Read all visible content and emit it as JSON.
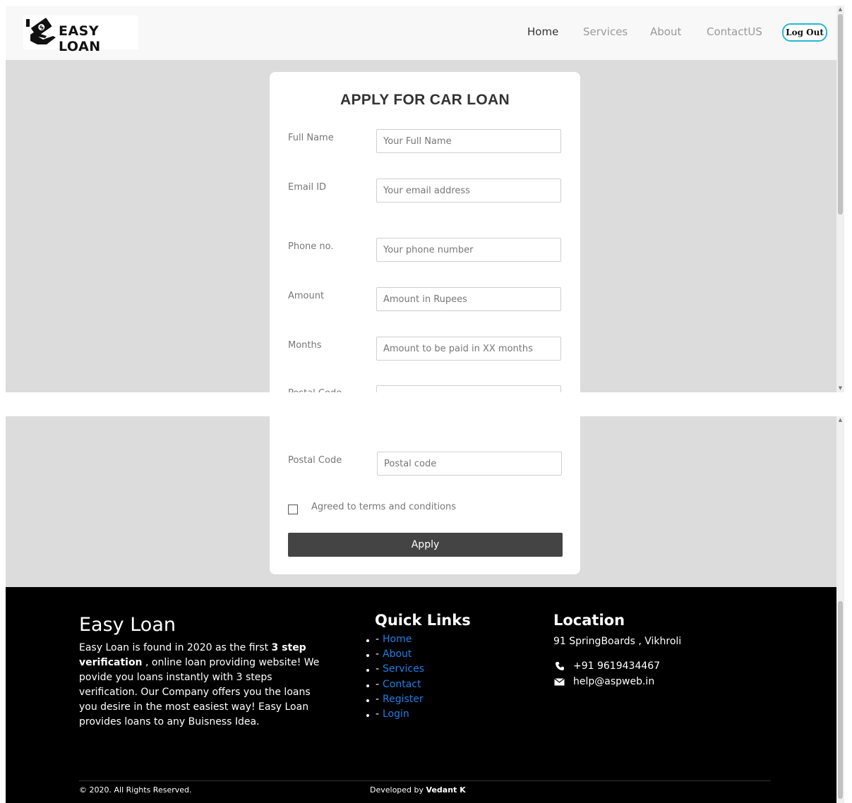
{
  "nav": {
    "brand": "EASY LOAN",
    "links": [
      "Home",
      "Services",
      "About",
      "ContactUS"
    ],
    "logout": "Log Out"
  },
  "form": {
    "title": "APPLY FOR CAR LOAN",
    "fields": [
      {
        "label": "Full Name",
        "placeholder": "Your Full Name"
      },
      {
        "label": "Email ID",
        "placeholder": "Your email address"
      },
      {
        "label": "Phone no.",
        "placeholder": "Your phone number"
      },
      {
        "label": "Amount",
        "placeholder": "Amount in Rupees"
      },
      {
        "label": "Months",
        "placeholder": "Amount to be paid in XX months"
      },
      {
        "label": "Postal Code",
        "placeholder": "Postal code"
      }
    ],
    "terms": "Agreed to terms and conditions",
    "submit": "Apply"
  },
  "footer": {
    "title": "Easy Loan",
    "desc_a": "Easy Loan is found in 2020 as the first ",
    "desc_bold": "3 step verification",
    "desc_b": " , online loan providing website! We povide you loans instantly with 3 steps verification. Our Company offers you the loans you desire in the most easiest way! Easy Loan provides loans to any Buisness Idea.",
    "quick_title": "Quick Links",
    "quick_links": [
      "Home",
      "About",
      "Services",
      "Contact",
      "Register",
      "Login"
    ],
    "link_prefix": "-",
    "loc_title": "Location",
    "address": "91 SpringBoards , Vikhroli",
    "phone": "+91 9619434467",
    "email": "help@aspweb.in",
    "copyright": "© 2020. All Rights Reserved.",
    "dev_prefix": "Developed by ",
    "dev_name": "Vedant K"
  },
  "icons": [
    "money-hand-logo-icon",
    "phone-icon",
    "envelope-icon",
    "scroll-up-arrow-icon",
    "scroll-down-arrow-icon"
  ]
}
